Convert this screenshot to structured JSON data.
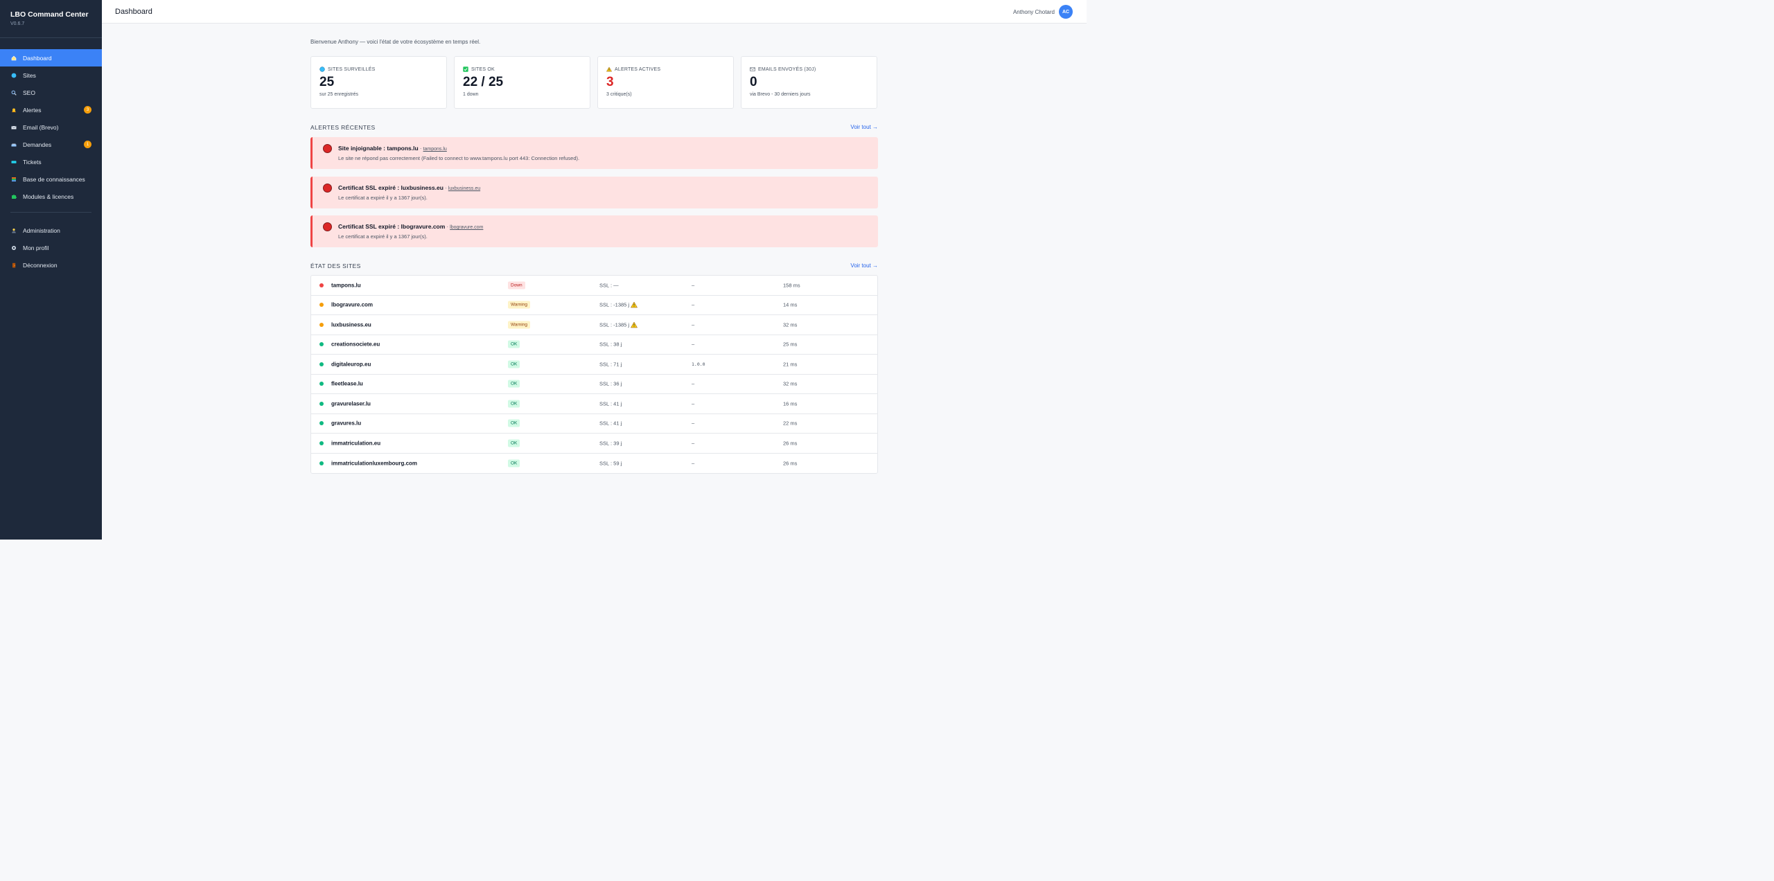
{
  "app": {
    "title": "LBO Command Center",
    "version": "V0.6.7"
  },
  "sidebar": {
    "items": [
      {
        "label": "Dashboard",
        "icon": "home-icon"
      },
      {
        "label": "Sites",
        "icon": "globe-icon"
      },
      {
        "label": "SEO",
        "icon": "magnifier-icon"
      },
      {
        "label": "Alertes",
        "icon": "bell-icon",
        "badge": "3"
      },
      {
        "label": "Email (Brevo)",
        "icon": "envelope-icon"
      },
      {
        "label": "Demandes",
        "icon": "inbox-icon",
        "badge": "1"
      },
      {
        "label": "Tickets",
        "icon": "ticket-icon"
      },
      {
        "label": "Base de connaissances",
        "icon": "books-icon"
      },
      {
        "label": "Modules & licences",
        "icon": "puzzle-icon"
      }
    ],
    "bottom_items": [
      {
        "label": "Administration",
        "icon": "admin-icon"
      },
      {
        "label": "Mon profil",
        "icon": "gear-icon"
      },
      {
        "label": "Déconnexion",
        "icon": "door-icon"
      }
    ]
  },
  "header": {
    "title": "Dashboard",
    "user_name": "Anthony Chotard",
    "avatar_initials": "AC"
  },
  "welcome": "Bienvenue Anthony — voici l'état de votre écosystème en temps réel.",
  "stats": [
    {
      "label": "SITES SURVEILLÉS",
      "icon": "globe-icon",
      "value": "25",
      "sub": "sur 25 enregistrés"
    },
    {
      "label": "SITES OK",
      "icon": "check-box-icon",
      "value": "22 / 25",
      "sub": "1 down"
    },
    {
      "label": "ALERTES ACTIVES",
      "icon": "warning-icon",
      "value": "3",
      "sub": "3 critique(s)"
    },
    {
      "label": "EMAILS ENVOYÉS (30J)",
      "icon": "envelope-icon",
      "value": "0",
      "sub": "via Brevo - 30 derniers jours"
    }
  ],
  "alerts_section": {
    "title": "ALERTES RÉCENTES",
    "link": "Voir tout →",
    "items": [
      {
        "title": "Site injoignable : tampons.lu",
        "link": "tampons.lu",
        "message": "Le site ne répond pas correctement (Failed to connect to www.tampons.lu port 443: Connection refused)."
      },
      {
        "title": "Certificat SSL expiré : luxbusiness.eu",
        "link": "luxbusiness.eu",
        "message": "Le certificat a expiré il y a 1367 jour(s)."
      },
      {
        "title": "Certificat SSL expiré : lbogravure.com",
        "link": "lbogravure.com",
        "message": "Le certificat a expiré il y a 1367 jour(s)."
      }
    ]
  },
  "sites_section": {
    "title": "ÉTAT DES SITES",
    "link": "Voir tout →",
    "rows": [
      {
        "name": "tampons.lu",
        "status": "Down",
        "ssl": "SSL : —",
        "ssl_warn": false,
        "version": "–",
        "response": "158 ms"
      },
      {
        "name": "lbogravure.com",
        "status": "Warning",
        "ssl": "SSL : -1385 j",
        "ssl_warn": true,
        "version": "–",
        "response": "14 ms"
      },
      {
        "name": "luxbusiness.eu",
        "status": "Warning",
        "ssl": "SSL : -1385 j",
        "ssl_warn": true,
        "version": "–",
        "response": "32 ms"
      },
      {
        "name": "creationsociete.eu",
        "status": "OK",
        "ssl": "SSL : 38 j",
        "ssl_warn": false,
        "version": "–",
        "response": "25 ms"
      },
      {
        "name": "digitaleurop.eu",
        "status": "OK",
        "ssl": "SSL : 71 j",
        "ssl_warn": false,
        "version": "1.0.0",
        "response": "21 ms"
      },
      {
        "name": "fleetlease.lu",
        "status": "OK",
        "ssl": "SSL : 36 j",
        "ssl_warn": false,
        "version": "–",
        "response": "32 ms"
      },
      {
        "name": "gravurelaser.lu",
        "status": "OK",
        "ssl": "SSL : 41 j",
        "ssl_warn": false,
        "version": "–",
        "response": "16 ms"
      },
      {
        "name": "gravures.lu",
        "status": "OK",
        "ssl": "SSL : 41 j",
        "ssl_warn": false,
        "version": "–",
        "response": "22 ms"
      },
      {
        "name": "immatriculation.eu",
        "status": "OK",
        "ssl": "SSL : 39 j",
        "ssl_warn": false,
        "version": "–",
        "response": "26 ms"
      },
      {
        "name": "immatriculationluxembourg.com",
        "status": "OK",
        "ssl": "SSL : 59 j",
        "ssl_warn": false,
        "version": "–",
        "response": "26 ms"
      }
    ]
  },
  "colors": {
    "sidebar_bg": "#1e293b",
    "accent": "#3b82f6",
    "danger": "#dc2626",
    "warning": "#f59e0b",
    "success": "#10b981"
  }
}
